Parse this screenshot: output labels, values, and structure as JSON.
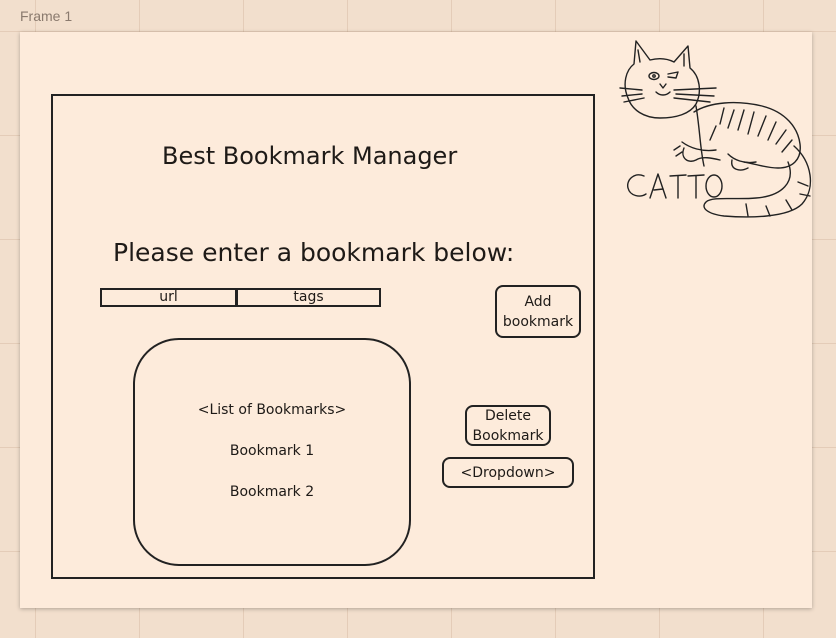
{
  "frame": {
    "label": "Frame 1"
  },
  "app": {
    "title": "Best Bookmark Manager",
    "prompt": "Please enter a bookmark below:"
  },
  "form": {
    "url_label": "url",
    "tags_label": "tags",
    "add_button": "Add bookmark"
  },
  "bookmarks": {
    "header": "<List of Bookmarks>",
    "items": [
      "Bookmark 1",
      "Bookmark 2"
    ]
  },
  "actions": {
    "delete_button": "Delete Bookmark",
    "dropdown": "<Dropdown>"
  },
  "doodle": {
    "caption": "CATTO"
  }
}
